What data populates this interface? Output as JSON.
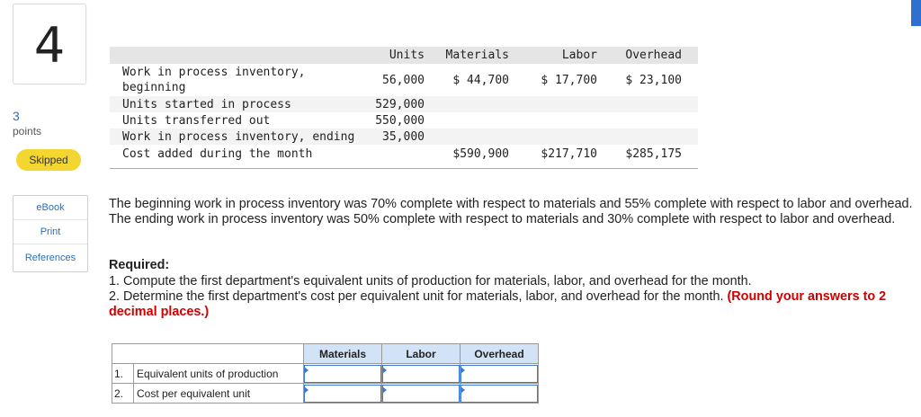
{
  "question": {
    "number": "4",
    "points_value": "3",
    "points_label": "points",
    "status": "Skipped"
  },
  "resources": [
    "eBook",
    "Print",
    "References"
  ],
  "data_table": {
    "headers": [
      "",
      "Units",
      "Materials",
      "Labor",
      "Overhead"
    ],
    "rows": [
      {
        "label_line1": "Work in process inventory,",
        "label_line2": "beginning",
        "units": "56,000",
        "materials": "$ 44,700",
        "labor": "$ 17,700",
        "overhead": "$ 23,100"
      },
      {
        "label_line1": "Units started in process",
        "units": "529,000",
        "materials": "",
        "labor": "",
        "overhead": ""
      },
      {
        "label_line1": "Units transferred out",
        "units": "550,000",
        "materials": "",
        "labor": "",
        "overhead": ""
      },
      {
        "label_line1": "Work in process inventory, ending",
        "units": "35,000",
        "materials": "",
        "labor": "",
        "overhead": ""
      },
      {
        "label_line1": "Cost added during the month",
        "units": "",
        "materials": "$590,900",
        "labor": "$217,710",
        "overhead": "$285,175"
      }
    ]
  },
  "paragraph": "The beginning work in process inventory was 70% complete with respect to materials and 55% complete with respect to labor and overhead. The ending work in process inventory was 50% complete with respect to materials and 30% complete with respect to labor and overhead.",
  "required": {
    "title": "Required:",
    "item1": "1. Compute the first department's equivalent units of production for materials, labor, and overhead for the month.",
    "item2": "2. Determine the first department's cost per equivalent unit for materials, labor, and overhead for the month.",
    "item2_emphasis": "(Round your answers to 2 decimal places.)"
  },
  "answer_table": {
    "columns": [
      "Materials",
      "Labor",
      "Overhead"
    ],
    "rows": [
      {
        "num": "1.",
        "label": "Equivalent units of production",
        "values": [
          "",
          "",
          ""
        ]
      },
      {
        "num": "2.",
        "label": "Cost per equivalent unit",
        "values": [
          "",
          "",
          ""
        ]
      }
    ]
  },
  "colors": {
    "accent_blue": "#2e6fcf",
    "skipped_badge": "#f4d631",
    "required_red": "#d00000",
    "answer_header": "#d3e3f7"
  }
}
